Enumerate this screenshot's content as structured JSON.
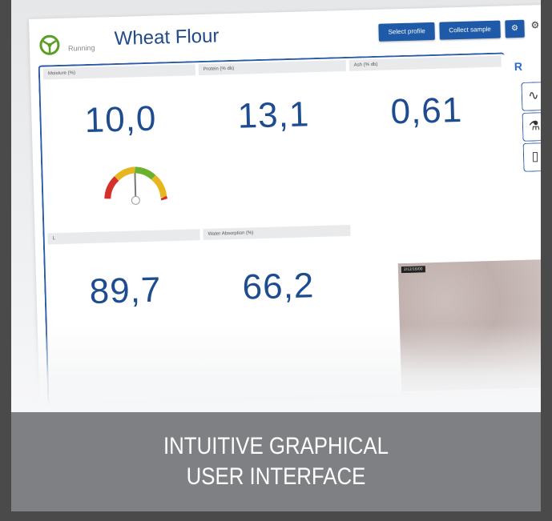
{
  "app": {
    "status": "Running",
    "title": "Wheat Flour"
  },
  "toolbar": {
    "select_profile": "Select profile",
    "collect_sample": "Collect sample"
  },
  "tiles": [
    {
      "label": "Moisture (%)",
      "value": "10,0"
    },
    {
      "label": "Protein (% db)",
      "value": "13,1"
    },
    {
      "label": "Ash (% db)",
      "value": "0,61"
    },
    {
      "label": "L",
      "value": "89,7"
    },
    {
      "label": "Water Absorption (%)",
      "value": "66,2"
    }
  ],
  "image_tile": {
    "label": "2/12/16/00"
  },
  "gauge": {
    "level": 0.5
  },
  "rail": {
    "top_label": "R"
  },
  "banner": {
    "line1": "INTUITIVE GRAPHICAL",
    "line2": "USER INTERFACE"
  },
  "colors": {
    "accent": "#1f5aa8",
    "value_text": "#1d4c91",
    "logo_green": "#5a9e24",
    "banner_bg": "#7f8083",
    "background": "#4a4a4a"
  },
  "icons": [
    "steering-wheel-logo-icon",
    "gear-icon",
    "waveform-icon",
    "flask-icon",
    "document-icon"
  ]
}
